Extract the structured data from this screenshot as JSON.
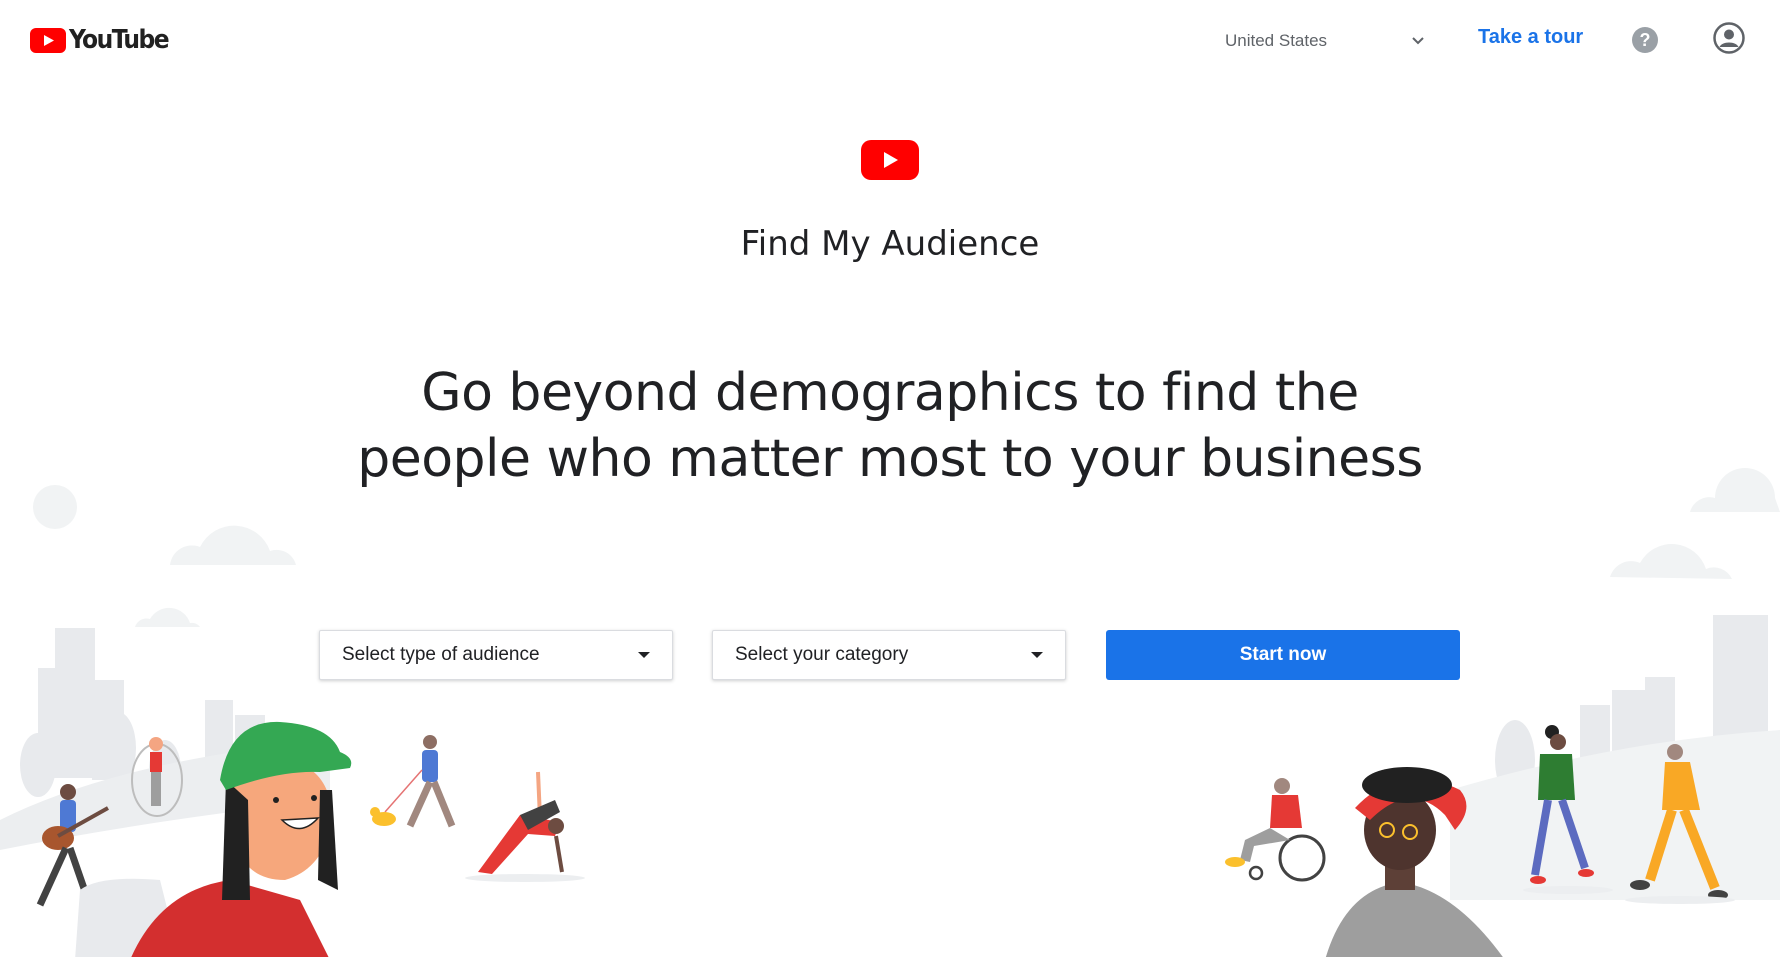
{
  "header": {
    "logo_text": "YouTube",
    "country_label": "United States",
    "tour_label": "Take a tour",
    "help_icon": "help-circle-icon",
    "account_icon": "account-circle-icon"
  },
  "hero": {
    "title": "Find My Audience",
    "headline_line1": "Go beyond demographics to find the",
    "headline_line2": "people who matter most to your business"
  },
  "form": {
    "audience_select_label": "Select type of audience",
    "category_select_label": "Select your category",
    "start_button_label": "Start now"
  },
  "colors": {
    "brand_red": "#ff0000",
    "accent_blue": "#1a73e8",
    "text": "#202124",
    "muted": "#5f6368"
  }
}
